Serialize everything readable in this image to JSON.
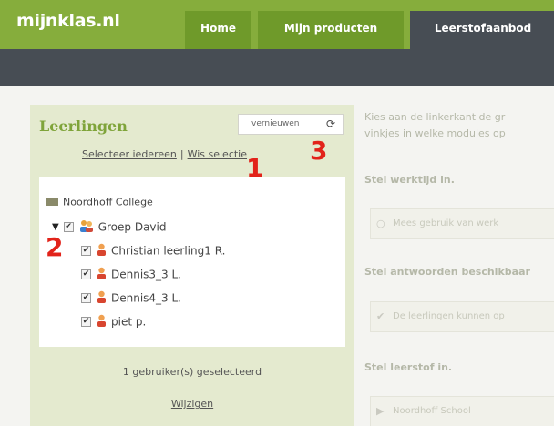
{
  "header": {
    "logo": "mijnklas.nl",
    "tabs": [
      {
        "label": "Home"
      },
      {
        "label": "Mijn producten"
      },
      {
        "label": "Leerstofaanbod"
      }
    ]
  },
  "panel": {
    "title": "Leerlingen",
    "refresh_label": "vernieuwen",
    "select_all": "Selecteer iedereen",
    "separator": "|",
    "clear_selection": "Wis selectie",
    "school": "Noordhoff College",
    "group": "Groep David",
    "students": [
      {
        "name": "Christian leerling1 R."
      },
      {
        "name": "Dennis3_3 L."
      },
      {
        "name": "Dennis4_3 L."
      },
      {
        "name": "piet p."
      }
    ],
    "selected_count": "1 gebruiker(s) geselecteerd",
    "change_link": "Wijzigen"
  },
  "annotations": {
    "one": "1",
    "two": "2",
    "three": "3"
  },
  "right": {
    "intro_1": "Kies aan de linkerkant de gr",
    "intro_2": "vinkjes in welke modules op",
    "heading_1": "Stel werktijd in.",
    "field_1": "Mees gebruik van werk",
    "heading_2": "Stel antwoorden beschikbaar",
    "field_2": "De leerlingen kunnen op",
    "heading_3": "Stel leerstof in.",
    "field_3": "Noordhoff School"
  },
  "colors": {
    "brand_green": "#86ad3c",
    "dark_bar": "#474d54",
    "panel_bg": "#e4eacf",
    "annotation_red": "#e2231a"
  }
}
